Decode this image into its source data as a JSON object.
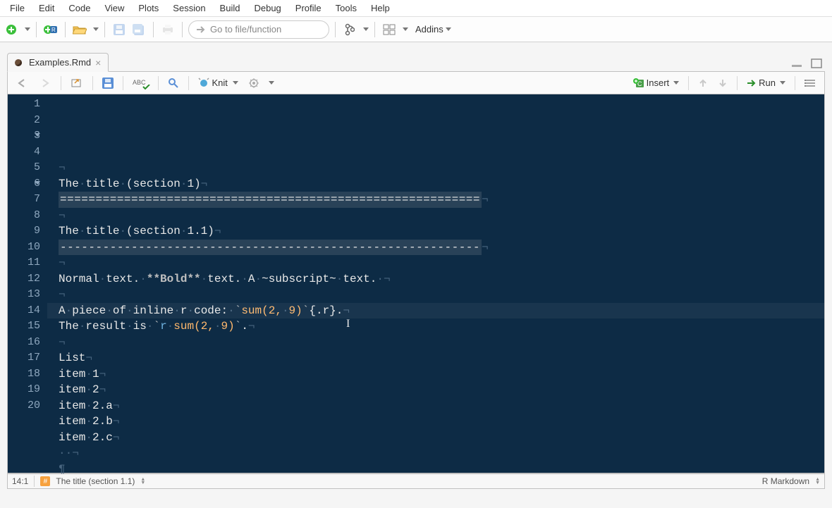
{
  "menubar": [
    "File",
    "Edit",
    "Code",
    "View",
    "Plots",
    "Session",
    "Build",
    "Debug",
    "Profile",
    "Tools",
    "Help"
  ],
  "main_toolbar": {
    "goto_placeholder": "Go to file/function",
    "addins_label": "Addins"
  },
  "tab": {
    "filename": "Examples.Rmd"
  },
  "editor_toolbar": {
    "knit_label": "Knit",
    "insert_label": "Insert",
    "run_label": "Run"
  },
  "editor": {
    "cursor_line": 14,
    "lines": [
      {
        "n": 1,
        "segs": [
          {
            "t": "¬",
            "c": "ws"
          }
        ]
      },
      {
        "n": 2,
        "segs": [
          {
            "t": "The",
            "c": ""
          },
          {
            "t": "·",
            "c": "ws"
          },
          {
            "t": "title",
            "c": ""
          },
          {
            "t": "·",
            "c": "ws"
          },
          {
            "t": "(section",
            "c": ""
          },
          {
            "t": "·",
            "c": "ws"
          },
          {
            "t": "1)",
            "c": ""
          },
          {
            "t": "¬",
            "c": "ws"
          }
        ]
      },
      {
        "n": 3,
        "fold": true,
        "segs": [
          {
            "t": "===========================================================",
            "c": "hr-line"
          },
          {
            "t": "¬",
            "c": "ws"
          }
        ]
      },
      {
        "n": 4,
        "segs": [
          {
            "t": "¬",
            "c": "ws"
          }
        ]
      },
      {
        "n": 5,
        "segs": [
          {
            "t": "The",
            "c": ""
          },
          {
            "t": "·",
            "c": "ws"
          },
          {
            "t": "title",
            "c": ""
          },
          {
            "t": "·",
            "c": "ws"
          },
          {
            "t": "(section",
            "c": ""
          },
          {
            "t": "·",
            "c": "ws"
          },
          {
            "t": "1.1)",
            "c": ""
          },
          {
            "t": "¬",
            "c": "ws"
          }
        ]
      },
      {
        "n": 6,
        "fold": true,
        "segs": [
          {
            "t": "-----------------------------------------------------------",
            "c": "hr-line"
          },
          {
            "t": "¬",
            "c": "ws"
          }
        ]
      },
      {
        "n": 7,
        "segs": [
          {
            "t": "¬",
            "c": "ws"
          }
        ]
      },
      {
        "n": 8,
        "segs": [
          {
            "t": "Normal",
            "c": ""
          },
          {
            "t": "·",
            "c": "ws"
          },
          {
            "t": "text.",
            "c": ""
          },
          {
            "t": "·",
            "c": "ws"
          },
          {
            "t": "**Bold**",
            "c": "bold-md"
          },
          {
            "t": "·",
            "c": "ws"
          },
          {
            "t": "text.",
            "c": ""
          },
          {
            "t": "·",
            "c": "ws"
          },
          {
            "t": "A",
            "c": ""
          },
          {
            "t": "·",
            "c": "ws"
          },
          {
            "t": "~subscript~",
            "c": ""
          },
          {
            "t": "·",
            "c": "ws"
          },
          {
            "t": "text.",
            "c": ""
          },
          {
            "t": "·",
            "c": "ws"
          },
          {
            "t": "¬",
            "c": "ws"
          }
        ]
      },
      {
        "n": 9,
        "segs": [
          {
            "t": "¬",
            "c": "ws"
          }
        ]
      },
      {
        "n": 10,
        "segs": [
          {
            "t": "A",
            "c": ""
          },
          {
            "t": "·",
            "c": "ws"
          },
          {
            "t": "piece",
            "c": ""
          },
          {
            "t": "·",
            "c": "ws"
          },
          {
            "t": "of",
            "c": ""
          },
          {
            "t": "·",
            "c": "ws"
          },
          {
            "t": "inline",
            "c": ""
          },
          {
            "t": "·",
            "c": "ws"
          },
          {
            "t": "r",
            "c": ""
          },
          {
            "t": "·",
            "c": "ws"
          },
          {
            "t": "code:",
            "c": ""
          },
          {
            "t": "·",
            "c": "ws"
          },
          {
            "t": "`",
            "c": "tick"
          },
          {
            "t": "sum(2,",
            "c": "code-inline"
          },
          {
            "t": "·",
            "c": "ws"
          },
          {
            "t": "9)",
            "c": "code-inline"
          },
          {
            "t": "`",
            "c": "tick"
          },
          {
            "t": "{.r}.",
            "c": ""
          },
          {
            "t": "¬",
            "c": "ws"
          }
        ]
      },
      {
        "n": 11,
        "segs": [
          {
            "t": "The",
            "c": ""
          },
          {
            "t": "·",
            "c": "ws"
          },
          {
            "t": "result",
            "c": ""
          },
          {
            "t": "·",
            "c": "ws"
          },
          {
            "t": "is",
            "c": ""
          },
          {
            "t": "·",
            "c": "ws"
          },
          {
            "t": "`",
            "c": "tick"
          },
          {
            "t": "r",
            "c": "code-inline2"
          },
          {
            "t": "·",
            "c": "ws"
          },
          {
            "t": "sum(2,",
            "c": "code-inline"
          },
          {
            "t": "·",
            "c": "ws"
          },
          {
            "t": "9)",
            "c": "code-inline"
          },
          {
            "t": "`",
            "c": "tick"
          },
          {
            "t": ".",
            "c": ""
          },
          {
            "t": "¬",
            "c": "ws"
          }
        ]
      },
      {
        "n": 12,
        "segs": [
          {
            "t": "¬",
            "c": "ws"
          }
        ]
      },
      {
        "n": 13,
        "segs": [
          {
            "t": "List",
            "c": ""
          },
          {
            "t": "¬",
            "c": "ws"
          }
        ]
      },
      {
        "n": 14,
        "segs": [
          {
            "t": "item",
            "c": ""
          },
          {
            "t": "·",
            "c": "ws"
          },
          {
            "t": "1",
            "c": ""
          },
          {
            "t": "¬",
            "c": "ws"
          }
        ]
      },
      {
        "n": 15,
        "segs": [
          {
            "t": "item",
            "c": ""
          },
          {
            "t": "·",
            "c": "ws"
          },
          {
            "t": "2",
            "c": ""
          },
          {
            "t": "¬",
            "c": "ws"
          }
        ]
      },
      {
        "n": 16,
        "segs": [
          {
            "t": "item",
            "c": ""
          },
          {
            "t": "·",
            "c": "ws"
          },
          {
            "t": "2.a",
            "c": ""
          },
          {
            "t": "¬",
            "c": "ws"
          }
        ]
      },
      {
        "n": 17,
        "segs": [
          {
            "t": "item",
            "c": ""
          },
          {
            "t": "·",
            "c": "ws"
          },
          {
            "t": "2.b",
            "c": ""
          },
          {
            "t": "¬",
            "c": "ws"
          }
        ]
      },
      {
        "n": 18,
        "segs": [
          {
            "t": "item",
            "c": ""
          },
          {
            "t": "·",
            "c": "ws"
          },
          {
            "t": "2.c",
            "c": ""
          },
          {
            "t": "¬",
            "c": "ws"
          }
        ]
      },
      {
        "n": 19,
        "segs": [
          {
            "t": "··",
            "c": "ws"
          },
          {
            "t": "¬",
            "c": "ws"
          }
        ]
      },
      {
        "n": 20,
        "segs": [
          {
            "t": "¶",
            "c": "pilcrow"
          }
        ]
      }
    ]
  },
  "statusbar": {
    "pos": "14:1",
    "outline": "The title (section 1.1)",
    "filetype": "R Markdown"
  }
}
